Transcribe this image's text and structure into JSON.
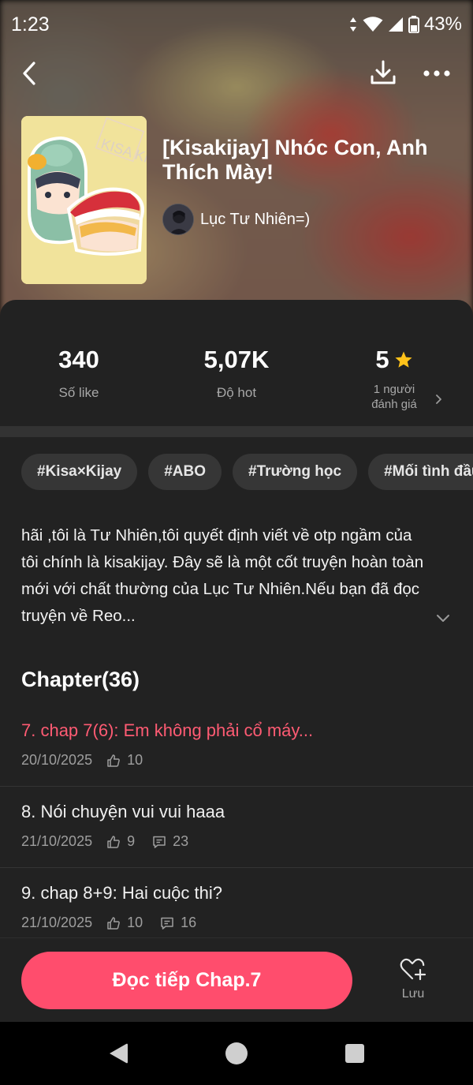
{
  "status_bar": {
    "time": "1:23",
    "battery": "43%"
  },
  "book": {
    "title": "[Kisakijay] Nhóc Con, Anh Thích Mày!",
    "author": "Lục Tư Nhiên=)",
    "cover_watermark": "KISA KIJAY"
  },
  "stats": {
    "likes_value": "340",
    "likes_label": "Số like",
    "hot_value": "5,07K",
    "hot_label": "Độ hot",
    "rating_value": "5",
    "rating_label_line1": "1 người",
    "rating_label_line2": "đánh giá"
  },
  "tags": [
    "#Kisa×Kijay",
    "#ABO",
    "#Trường học",
    "#Mối tình đầu"
  ],
  "description": "hãi ,tôi là Tư Nhiên,tôi quyết định viết về otp ngầm của tôi chính là kisakijay. Đây sẽ là một cốt truyện hoàn toàn mới với chất thường của Lục Tư Nhiên.Nếu bạn đã đọc truyện về Reo...",
  "chapters": {
    "heading": "Chapter(36)",
    "items": [
      {
        "title": "7. chap 7(6): Em không phải cổ máy...",
        "date": "20/10/2025",
        "likes": "10",
        "comments": ""
      },
      {
        "title": "8. Nói chuyện vui vui haaa",
        "date": "21/10/2025",
        "likes": "9",
        "comments": "23"
      },
      {
        "title": "9. chap 8+9: Hai cuộc thi?",
        "date": "21/10/2025",
        "likes": "10",
        "comments": "16"
      }
    ]
  },
  "actions": {
    "read_label": "Đọc tiếp Chap.7",
    "save_label": "Lưu"
  },
  "colors": {
    "accent": "#ff4d6d",
    "active_chapter": "#ff5b73",
    "star": "#ffc21a",
    "card_bg": "#222222"
  },
  "icons": {
    "back": "back-arrow-icon",
    "download": "download-icon",
    "more": "more-dots-icon",
    "star": "star-icon",
    "like": "thumbs-up-icon",
    "comment": "comment-icon",
    "expand": "chevron-down-icon",
    "save": "heart-plus-icon"
  }
}
